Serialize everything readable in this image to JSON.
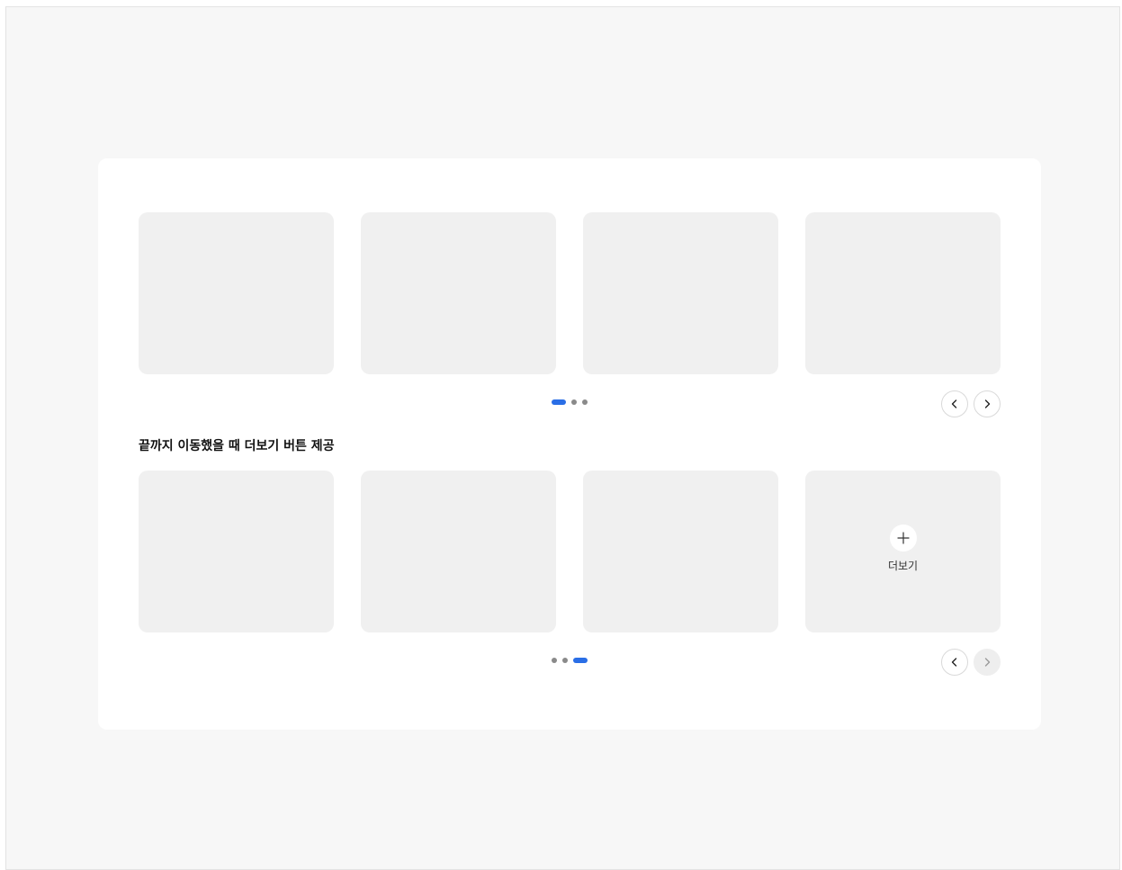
{
  "section": {
    "title": "끝까지 이동했을 때 더보기 버튼 제공"
  },
  "carousel_top": {
    "page_count": 3,
    "active_page": 1,
    "prev_enabled": true,
    "next_enabled": true
  },
  "carousel_bottom": {
    "page_count": 3,
    "active_page": 3,
    "prev_enabled": true,
    "next_enabled": false,
    "more_label": "더보기"
  },
  "colors": {
    "page_background": "#f7f7f7",
    "panel_background": "#ffffff",
    "card_background": "#f0f0f0",
    "active_dot": "#2a6ee6",
    "inactive_dot": "#8a8a8a"
  },
  "icons": {
    "prev": "chevron-left-icon",
    "next": "chevron-right-icon",
    "more": "plus-icon"
  }
}
